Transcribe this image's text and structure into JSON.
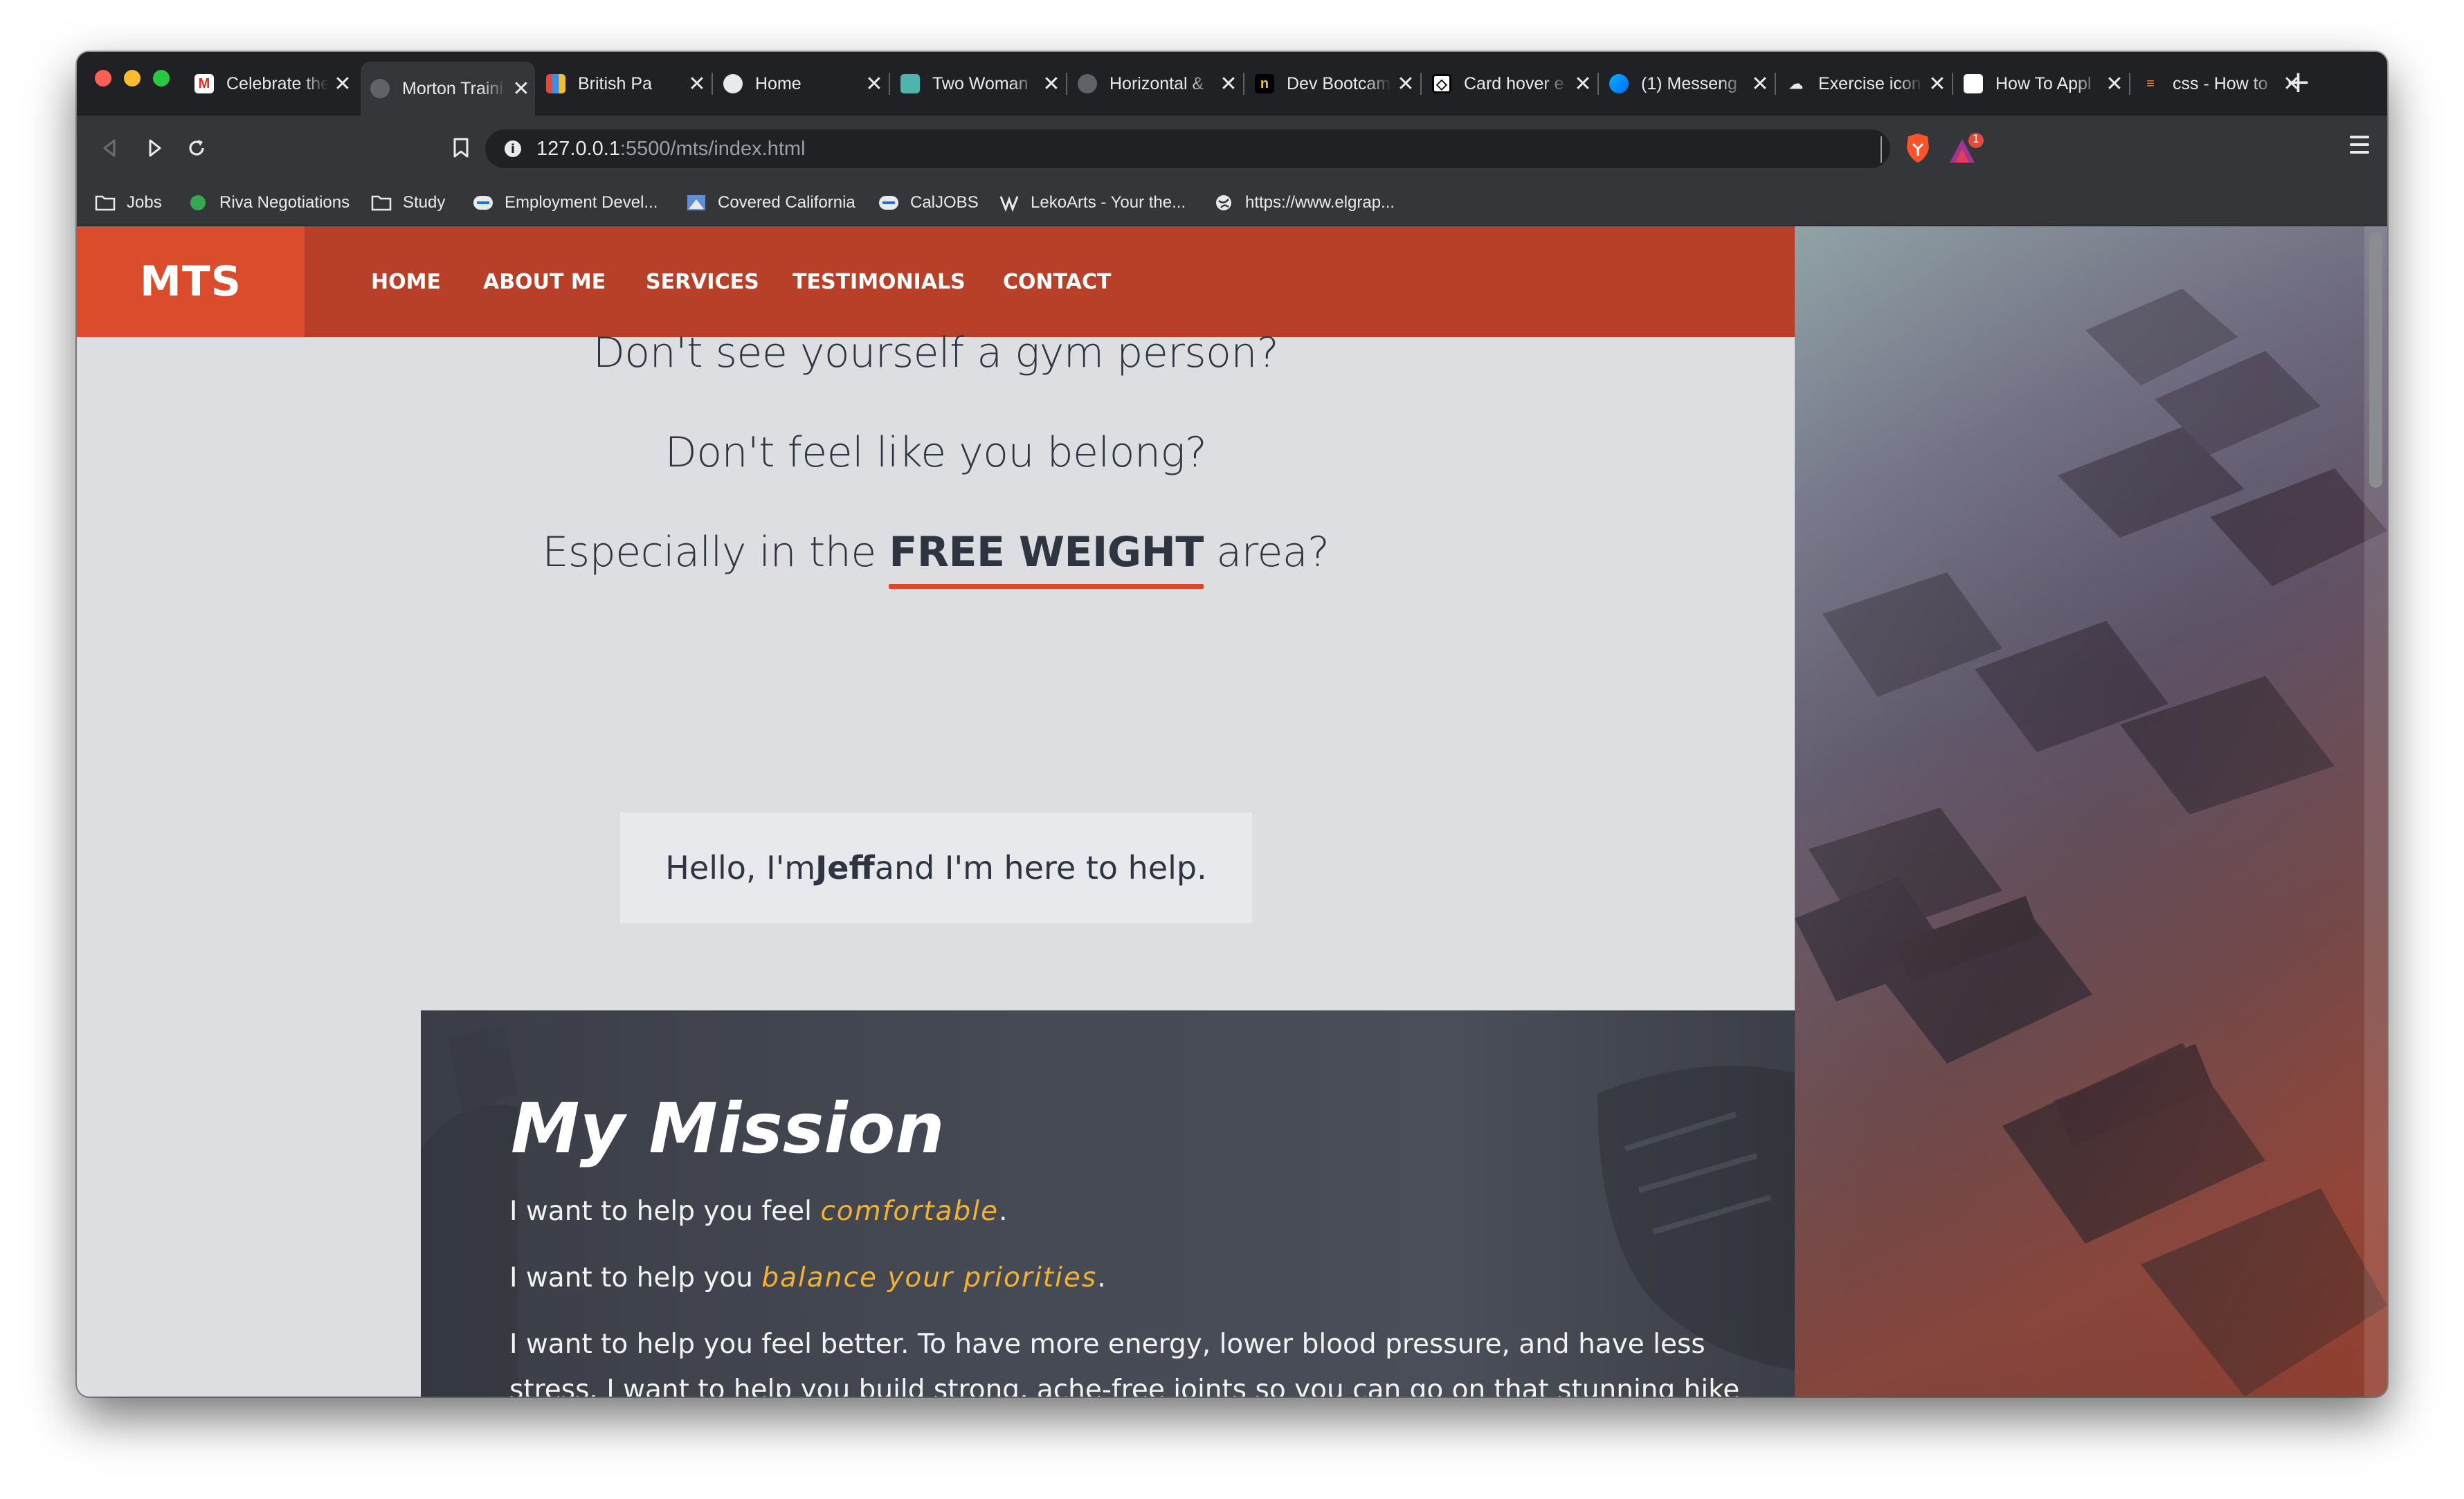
{
  "browser": {
    "tabs": [
      {
        "title": "Celebrate the",
        "favicon": "gmail-icon",
        "active": false
      },
      {
        "title": "Morton Traini",
        "favicon": "globe-icon",
        "active": true
      },
      {
        "title": "British Pa",
        "favicon": "flag-icon",
        "active": false
      },
      {
        "title": "Home",
        "favicon": "globe-icon",
        "active": false
      },
      {
        "title": "Two Woman",
        "favicon": "image-icon",
        "active": false
      },
      {
        "title": "Horizontal &",
        "favicon": "globe-icon",
        "active": false
      },
      {
        "title": "Dev Bootcam",
        "favicon": "dev-icon",
        "active": false
      },
      {
        "title": "Card hover e",
        "favicon": "codepen-icon",
        "active": false
      },
      {
        "title": "(1) Messeng",
        "favicon": "messenger-icon",
        "active": false
      },
      {
        "title": "Exercise icon",
        "favicon": "icon-site-icon",
        "active": false
      },
      {
        "title": "How To Appl",
        "favicon": "doc-icon",
        "active": false
      },
      {
        "title": "css - How to",
        "favicon": "stackoverflow-icon",
        "active": false
      }
    ],
    "new_tab_label": "+",
    "close_glyph": "✕",
    "url_host": "127.0.0.1",
    "url_path": ":5500/mts/index.html",
    "rewards_badge": "1",
    "bookmarks": [
      {
        "label": "Jobs",
        "icon": "folder-icon"
      },
      {
        "label": "Riva Negotiations",
        "icon": "site-icon"
      },
      {
        "label": "Study",
        "icon": "folder-icon"
      },
      {
        "label": "Employment Devel...",
        "icon": "edd-icon"
      },
      {
        "label": "Covered California",
        "icon": "site-icon"
      },
      {
        "label": "CalJOBS",
        "icon": "edd-icon"
      },
      {
        "label": "LekoArts - Your the...",
        "icon": "lekoarts-icon"
      },
      {
        "label": "https://www.elgrap...",
        "icon": "globe-icon"
      }
    ]
  },
  "site": {
    "brand": "MTS",
    "nav": [
      "HOME",
      "ABOUT ME",
      "SERVICES",
      "TESTIMONIALS",
      "CONTACT"
    ],
    "hero": {
      "line1": "Don't see yourself a gym person?",
      "line2": "Don't feel like you belong?",
      "line3_before": "Especially in the ",
      "line3_strong": "FREE WEIGHT",
      "line3_after": " area?"
    },
    "intro": {
      "before": "Hello, I'm ",
      "name": "Jeff",
      "after": " and I'm here to help."
    },
    "mission": {
      "title": "My Mission",
      "p1_before": "I want to help you feel ",
      "p1_accent": "comfortable",
      "p1_after": ".",
      "p2_before": "I want to help you ",
      "p2_accent": "balance your priorities",
      "p2_after": ".",
      "p3": "I want to help you feel better. To have more energy, lower blood pressure, and have less stress. I want to help you build strong, ache-free joints so you can go on that stunning hike without a"
    },
    "colors": {
      "nav_bg": "#b84028",
      "brand_bg": "#db4c2c",
      "accent_underline": "#d94a2b",
      "mission_accent": "#f2b233",
      "page_bg": "#dcdee2"
    }
  }
}
